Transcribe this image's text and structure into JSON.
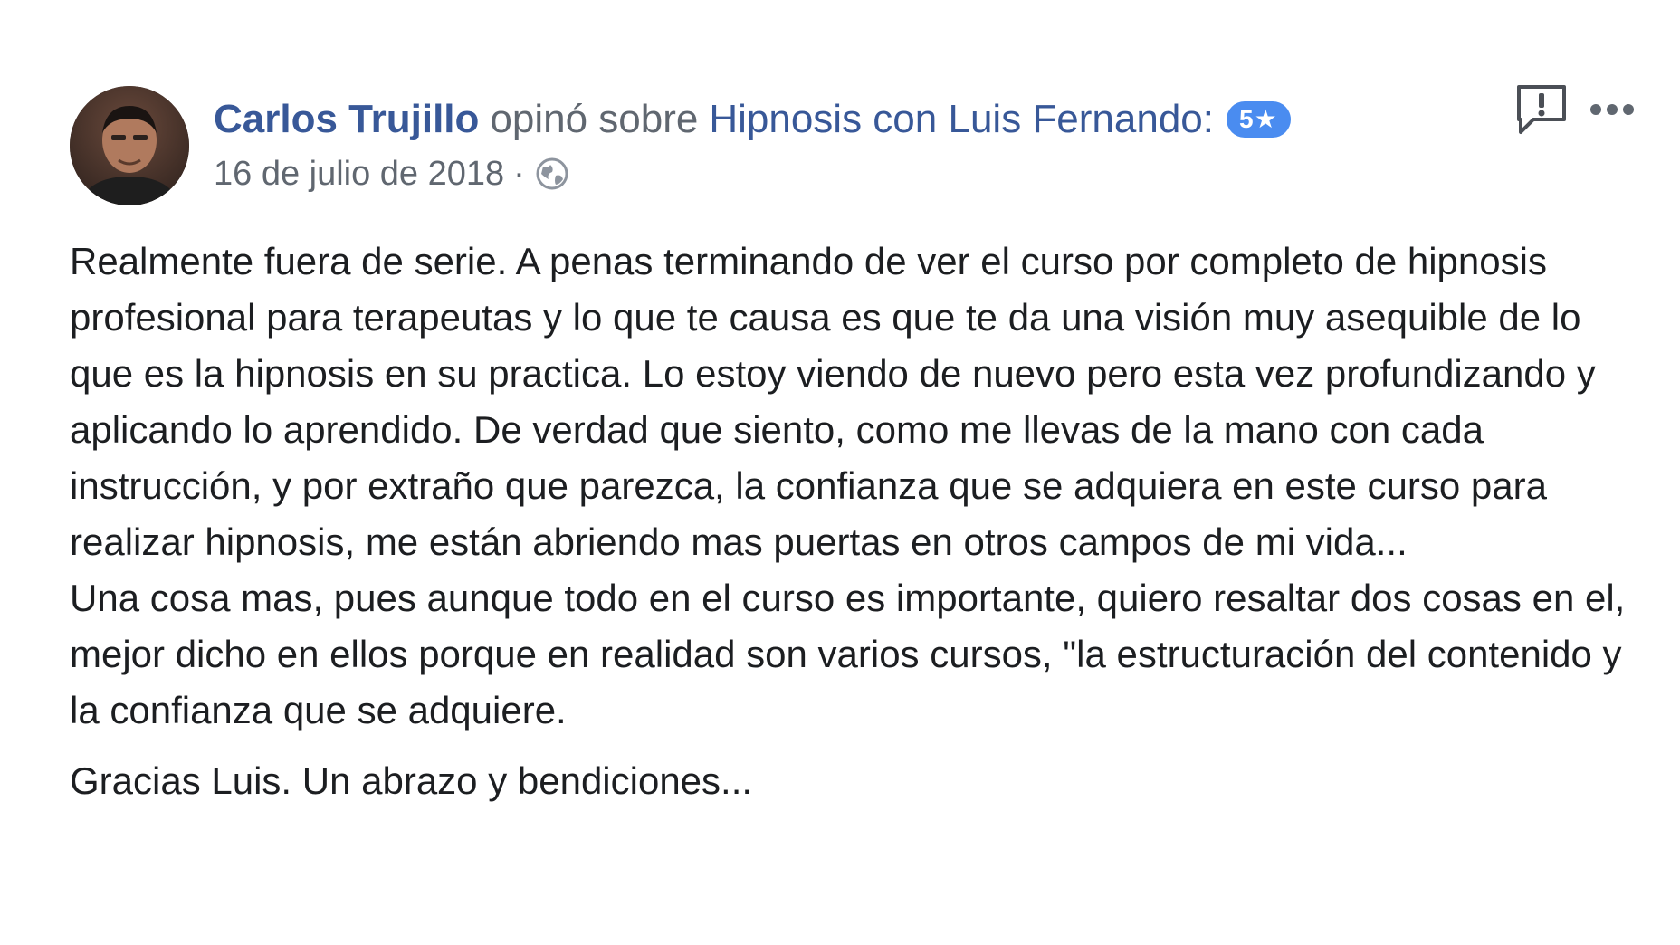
{
  "review": {
    "author_name": "Carlos Trujillo",
    "verb": "opinó sobre",
    "page_name": "Hipnosis con Luis Fernando:",
    "rating_badge": "5★",
    "rating": 5,
    "date": "16 de julio de 2018",
    "separator": "·",
    "privacy_icon": "globe-icon",
    "actions": {
      "report_icon": "report-icon",
      "more_icon": "more-options-icon"
    },
    "body": {
      "paragraph_1": "Realmente fuera de serie. A penas terminando de ver el curso por completo de hipnosis profesional para terapeutas y lo que te causa es que te da una visión muy asequible de lo que es la hipnosis en su practica. Lo estoy viendo de nuevo pero esta vez profundizando y aplicando lo aprendido. De verdad que siento, como me llevas de la mano con cada instrucción, y por extraño que parezca, la confianza que se adquiera en este curso para realizar hipnosis, me están abriendo mas puertas en otros campos de mi vida...",
      "paragraph_2": "Una cosa mas, pues aunque todo en el curso es importante, quiero resaltar dos cosas en el, mejor dicho en ellos porque en realidad son varios cursos, \"la estructuración del contenido y la confianza que se adquiere.",
      "paragraph_3": "Gracias Luis. Un abrazo y bendiciones..."
    }
  },
  "colors": {
    "link": "#385898",
    "secondary_text": "#606770",
    "body_text": "#1c1e21",
    "badge": "#4a8cf0"
  }
}
